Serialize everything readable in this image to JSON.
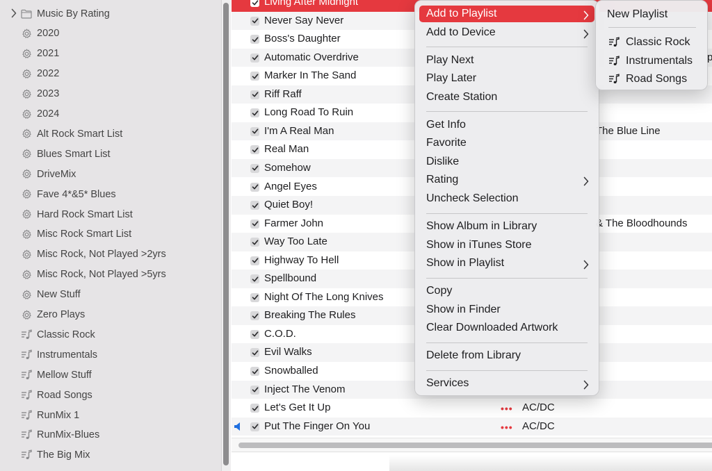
{
  "sidebar": {
    "items": [
      {
        "label": "Music By Rating",
        "icon": "folder-icon",
        "chevron": true
      },
      {
        "label": "2020",
        "icon": "gear-icon"
      },
      {
        "label": "2021",
        "icon": "gear-icon"
      },
      {
        "label": "2022",
        "icon": "gear-icon"
      },
      {
        "label": "2023",
        "icon": "gear-icon"
      },
      {
        "label": "2024",
        "icon": "gear-icon"
      },
      {
        "label": "Alt Rock Smart List",
        "icon": "gear-icon"
      },
      {
        "label": "Blues Smart List",
        "icon": "gear-icon"
      },
      {
        "label": "DriveMix",
        "icon": "gear-icon"
      },
      {
        "label": "Fave 4*&5* Blues",
        "icon": "gear-icon"
      },
      {
        "label": "Hard Rock Smart List",
        "icon": "gear-icon"
      },
      {
        "label": "Misc Rock Smart List",
        "icon": "gear-icon"
      },
      {
        "label": "Misc Rock, Not Played >2yrs",
        "icon": "gear-icon"
      },
      {
        "label": "Misc Rock, Not Played >5yrs",
        "icon": "gear-icon"
      },
      {
        "label": "New Stuff",
        "icon": "gear-icon"
      },
      {
        "label": "Zero Plays",
        "icon": "gear-icon"
      },
      {
        "label": "Classic Rock",
        "icon": "playlist-icon"
      },
      {
        "label": "Instrumentals",
        "icon": "playlist-icon"
      },
      {
        "label": "Mellow Stuff",
        "icon": "playlist-icon"
      },
      {
        "label": "Road Songs",
        "icon": "playlist-icon"
      },
      {
        "label": "RunMix 1",
        "icon": "playlist-icon"
      },
      {
        "label": "RunMix-Blues",
        "icon": "playlist-icon"
      },
      {
        "label": "The Big Mix",
        "icon": "playlist-icon"
      }
    ]
  },
  "tracks": [
    {
      "title": "Living After Midnight",
      "selected": true
    },
    {
      "title": "Never Say Never"
    },
    {
      "title": "Boss's Daughter"
    },
    {
      "title": "Automatic Overdrive",
      "extra": "p"
    },
    {
      "title": "Marker In The Sand"
    },
    {
      "title": "Riff Raff"
    },
    {
      "title": "Long Road To Ruin"
    },
    {
      "title": "I'm A Real Man",
      "extra": "The Blue Line"
    },
    {
      "title": "Real Man"
    },
    {
      "title": "Somehow"
    },
    {
      "title": "Angel Eyes"
    },
    {
      "title": "Quiet Boy!"
    },
    {
      "title": "Farmer John",
      "extra": "& The Bloodhounds"
    },
    {
      "title": "Way Too Late"
    },
    {
      "title": "Highway To Hell"
    },
    {
      "title": "Spellbound"
    },
    {
      "title": "Night Of The Long Knives"
    },
    {
      "title": "Breaking The Rules"
    },
    {
      "title": "C.O.D."
    },
    {
      "title": "Evil Walks"
    },
    {
      "title": "Snowballed"
    },
    {
      "title": "Inject The Venom"
    },
    {
      "title": "Let's Get It Up",
      "dots": "•••",
      "artist": "AC/DC"
    },
    {
      "title": "Put The Finger On You",
      "dots": "•••",
      "artist": "AC/DC",
      "playing": true
    }
  ],
  "context_menu": {
    "items": [
      {
        "label": "Add to Playlist",
        "submenu": true,
        "highlighted": true
      },
      {
        "label": "Add to Device",
        "submenu": true
      },
      {
        "separator": true
      },
      {
        "label": "Play Next"
      },
      {
        "label": "Play Later"
      },
      {
        "label": "Create Station"
      },
      {
        "separator": true
      },
      {
        "label": "Get Info"
      },
      {
        "label": "Favorite"
      },
      {
        "label": "Dislike"
      },
      {
        "label": "Rating",
        "submenu": true
      },
      {
        "label": "Uncheck Selection"
      },
      {
        "separator": true
      },
      {
        "label": "Show Album in Library"
      },
      {
        "label": "Show in iTunes Store"
      },
      {
        "label": "Show in Playlist",
        "submenu": true
      },
      {
        "separator": true
      },
      {
        "label": "Copy"
      },
      {
        "label": "Show in Finder"
      },
      {
        "label": "Clear Downloaded Artwork"
      },
      {
        "separator": true
      },
      {
        "label": "Delete from Library"
      },
      {
        "separator": true
      },
      {
        "label": "Services",
        "submenu": true
      }
    ]
  },
  "submenu": {
    "new_playlist": "New Playlist",
    "playlists": [
      "Classic Rock",
      "Instrumentals",
      "Road Songs"
    ]
  },
  "colors": {
    "accent": "#e5393f",
    "sidebar_bg": "#e6e4e6",
    "playing_icon": "#1f6fe0"
  }
}
